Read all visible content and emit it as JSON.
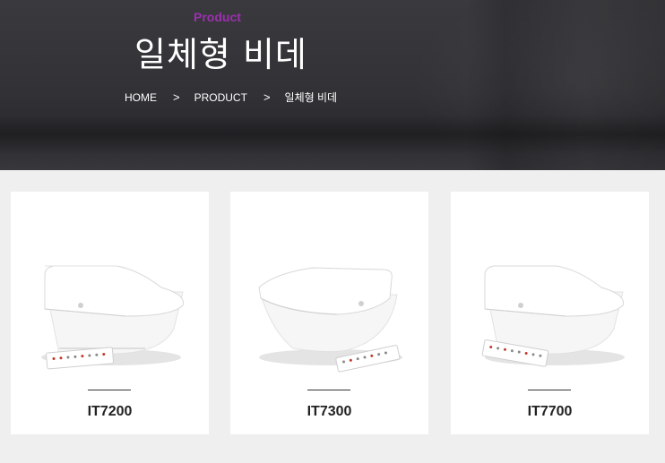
{
  "hero": {
    "eyebrow": "Product",
    "title": "일체형 비데",
    "breadcrumb": [
      {
        "label": "HOME"
      },
      {
        "label": "PRODUCT"
      },
      {
        "label": "일체형 비데"
      }
    ],
    "separator": ">"
  },
  "products": [
    {
      "name": "IT7200"
    },
    {
      "name": "IT7300"
    },
    {
      "name": "IT7700"
    }
  ]
}
